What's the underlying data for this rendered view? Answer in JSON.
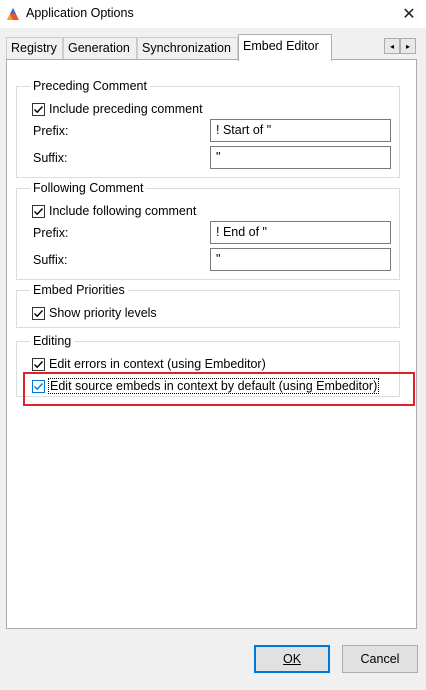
{
  "window": {
    "title": "Application Options",
    "close_glyph": "✕"
  },
  "tabs": [
    {
      "label": "Registry"
    },
    {
      "label": "Generation"
    },
    {
      "label": "Synchronization"
    },
    {
      "label": "Embed Editor",
      "active": true
    }
  ],
  "tab_scroll": {
    "left": "◂",
    "right": "▸"
  },
  "preceding": {
    "title": "Preceding Comment",
    "include_label": "Include preceding comment",
    "include_checked": true,
    "prefix_label": "Prefix:",
    "prefix_value": "! Start of \"",
    "suffix_label": "Suffix:",
    "suffix_value": "\""
  },
  "following": {
    "title": "Following Comment",
    "include_label": "Include following comment",
    "include_checked": true,
    "prefix_label": "Prefix:",
    "prefix_value": "! End of \"",
    "suffix_label": "Suffix:",
    "suffix_value": "\""
  },
  "priorities": {
    "title": "Embed Priorities",
    "show_label": "Show priority levels",
    "show_checked": true
  },
  "editing": {
    "title": "Editing",
    "errors_label": "Edit errors in context   (using Embeditor)",
    "errors_checked": true,
    "source_label": "Edit source embeds in context by default   (using Embeditor)",
    "source_checked": true
  },
  "buttons": {
    "ok": "OK",
    "cancel": "Cancel"
  },
  "colors": {
    "highlight": "#e0202a",
    "accent": "#0078d7"
  }
}
